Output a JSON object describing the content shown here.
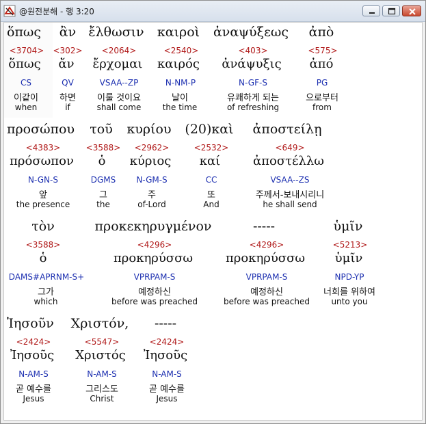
{
  "window": {
    "title": "@원전분해 - 행 3:20"
  },
  "rows": [
    {
      "header": [
        {
          "text": "ὅπως"
        },
        {
          "text": "ἂν"
        },
        {
          "text": "ἔλθωσιν"
        },
        {
          "text": "καιροὶ"
        },
        {
          "text": "ἀναψύξεως"
        },
        {
          "text": "ἀπὸ"
        }
      ],
      "words": [
        {
          "strong": "<3704>",
          "lemma": "ὅπως",
          "parse": "CS",
          "korean": "이같이",
          "english": "when"
        },
        {
          "strong": "<302>",
          "lemma": "ἄν",
          "parse": "QV",
          "korean": "하면",
          "english": "if"
        },
        {
          "strong": "<2064>",
          "lemma": "ἔρχομαι",
          "parse": "VSAA--ZP",
          "korean": "이룰 것이요",
          "english": "shall come"
        },
        {
          "strong": "<2540>",
          "lemma": "καιρός",
          "parse": "N-NM-P",
          "korean": "날이",
          "english": "the time"
        },
        {
          "strong": "<403>",
          "lemma": "ἀνάψυξις",
          "parse": "N-GF-S",
          "korean": "유쾌하게 되는",
          "english": "of refreshing"
        },
        {
          "strong": "<575>",
          "lemma": "ἀπό",
          "parse": "PG",
          "korean": "으로부터",
          "english": "from"
        }
      ]
    },
    {
      "header": [
        {
          "text": "προσώπου"
        },
        {
          "text": "τοῦ"
        },
        {
          "text": "κυρίου"
        },
        {
          "text": "(20)καὶ"
        },
        {
          "text": "ἀποστείλῃ"
        }
      ],
      "words": [
        {
          "strong": "<4383>",
          "lemma": "πρόσωπον",
          "parse": "N-GN-S",
          "korean": "앞",
          "english": "the presence"
        },
        {
          "strong": "<3588>",
          "lemma": "ὁ",
          "parse": "DGMS",
          "korean": "그",
          "english": "the"
        },
        {
          "strong": "<2962>",
          "lemma": "κύριος",
          "parse": "N-GM-S",
          "korean": "주",
          "english": "of-Lord"
        },
        {
          "strong": "<2532>",
          "lemma": "καί",
          "parse": "CC",
          "korean": "또",
          "english": "And"
        },
        {
          "strong": "<649>",
          "lemma": "ἀποστέλλω",
          "parse": "VSAA--ZS",
          "korean": "주께서-보내시리니",
          "english": "he shall send"
        }
      ]
    },
    {
      "header": [
        {
          "text": "τὸν"
        },
        {
          "text": "προκεκηρυγμένον"
        },
        {
          "text": "-----"
        },
        {
          "text": "ὑμῖν"
        }
      ],
      "words": [
        {
          "strong": "<3588>",
          "lemma": "ὁ",
          "parse": "DAMS#APRNM-S+",
          "korean": "그가",
          "english": "which"
        },
        {
          "strong": "<4296>",
          "lemma": "προκηρύσσω",
          "parse": "VPRPAM-S",
          "korean": "예정하신",
          "english": "before was preached"
        },
        {
          "strong": "<4296>",
          "lemma": "προκηρύσσω",
          "parse": "VPRPAM-S",
          "korean": "예정하신",
          "english": "before was preached"
        },
        {
          "strong": "<5213>",
          "lemma": "ὑμῖν",
          "parse": "NPD-YP",
          "korean": "너희를 위하여",
          "english": "unto you"
        }
      ]
    },
    {
      "header": [
        {
          "text": "Ἰησοῦν"
        },
        {
          "text": "Χριστόν,"
        },
        {
          "text": "-----"
        }
      ],
      "words": [
        {
          "strong": "<2424>",
          "lemma": "Ἰησοῦς",
          "parse": "N-AM-S",
          "korean": "곧 예수를",
          "english": "Jesus"
        },
        {
          "strong": "<5547>",
          "lemma": "Χριστός",
          "parse": "N-AM-S",
          "korean": "그리스도",
          "english": "Christ"
        },
        {
          "strong": "<2424>",
          "lemma": "Ἰησοῦς",
          "parse": "N-AM-S",
          "korean": "곧 예수를",
          "english": "Jesus"
        }
      ]
    }
  ]
}
